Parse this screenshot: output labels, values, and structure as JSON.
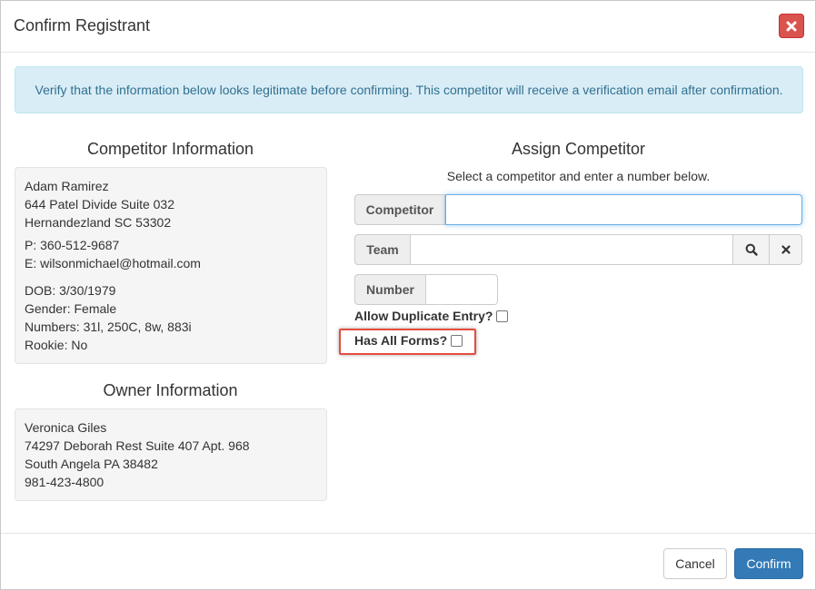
{
  "dialog": {
    "title": "Confirm Registrant",
    "close_icon": "close-icon",
    "close_color": "#d9534f"
  },
  "alert": {
    "message": "Verify that the information below looks legitimate before confirming. This competitor will receive a verification email after confirmation."
  },
  "competitor_info": {
    "heading": "Competitor Information",
    "name": "Adam Ramirez",
    "address1": "644 Patel Divide Suite 032",
    "address2": "Hernandezland SC 53302",
    "phone": "P: 360-512-9687",
    "email": "E: wilsonmichael@hotmail.com",
    "dob": "DOB: 3/30/1979",
    "gender": "Gender: Female",
    "numbers": "Numbers: 31l, 250C, 8w, 883i",
    "rookie": "Rookie: No"
  },
  "owner_info": {
    "heading": "Owner Information",
    "name": "Veronica Giles",
    "address1": "74297 Deborah Rest Suite 407 Apt. 968",
    "address2": "South Angela PA 38482",
    "phone": "981-423-4800"
  },
  "assign": {
    "heading": "Assign Competitor",
    "subtitle": "Select a competitor and enter a number below.",
    "competitor_label": "Competitor",
    "competitor_value": "",
    "team_label": "Team",
    "team_value": "",
    "search_icon": "search-icon",
    "clear_icon": "close-icon",
    "number_label": "Number",
    "number_value": "",
    "allow_duplicate_label": "Allow Duplicate Entry?",
    "allow_duplicate_checked": false,
    "has_all_forms_label": "Has All Forms?",
    "has_all_forms_checked": false,
    "highlight_color": "#e44d3f"
  },
  "footer": {
    "cancel_label": "Cancel",
    "confirm_label": "Confirm",
    "confirm_color": "#337ab7"
  }
}
